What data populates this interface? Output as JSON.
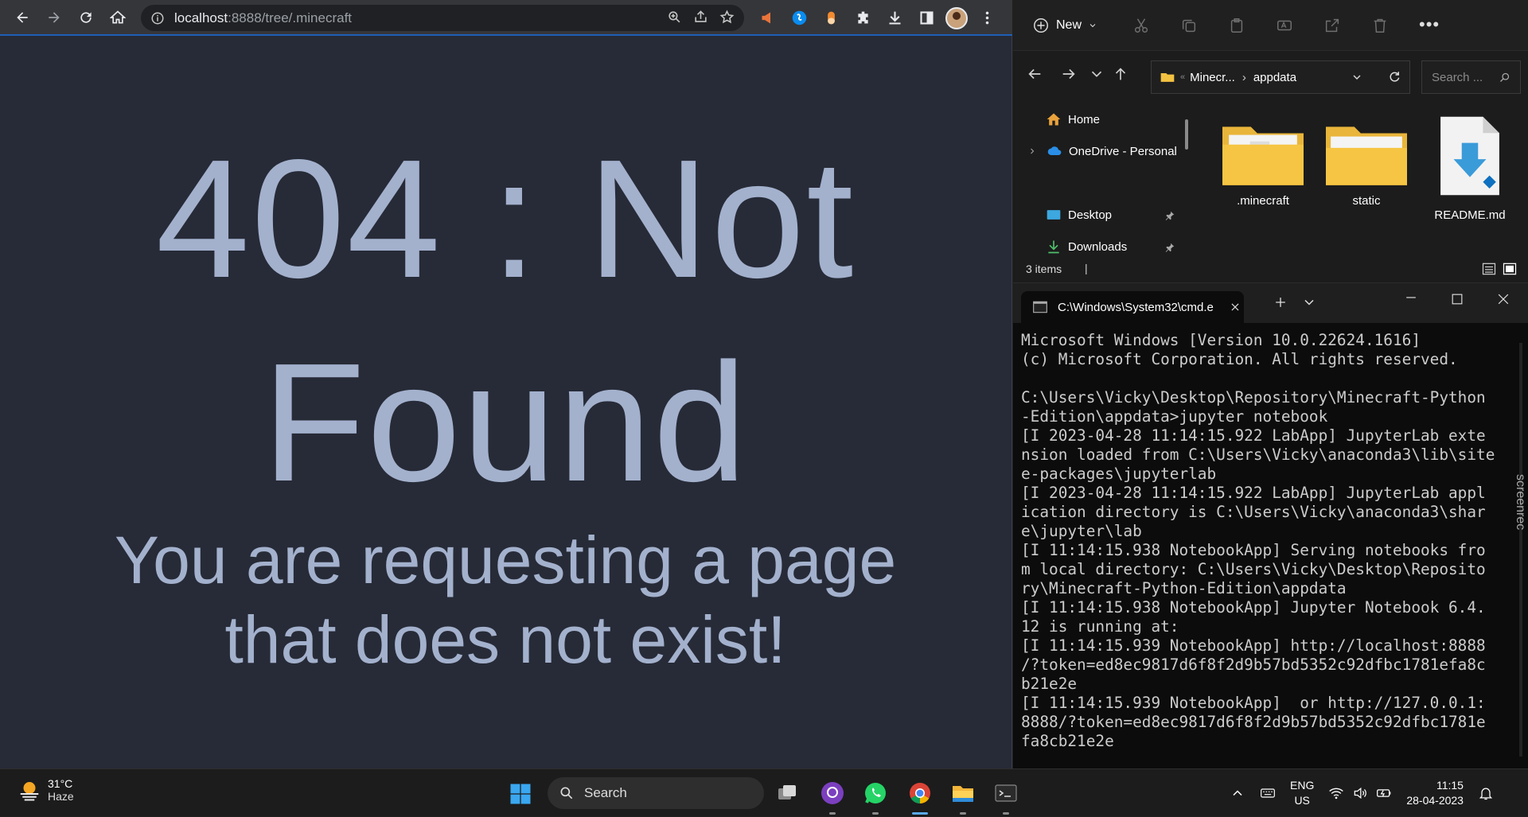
{
  "browser": {
    "url_host": "localhost",
    "url_path": ":8888/tree/.minecraft",
    "page": {
      "title_line1": "404 : Not",
      "title_line2": "Found",
      "subtitle_line1": "You are requesting a page",
      "subtitle_line2": "that does not exist!"
    }
  },
  "explorer": {
    "new_label": "New",
    "breadcrumb": [
      "Minecr...",
      "appdata"
    ],
    "search_placeholder": "Search ...",
    "nav": {
      "home": "Home",
      "onedrive": "OneDrive - Personal",
      "desktop": "Desktop",
      "downloads": "Downloads"
    },
    "files": [
      {
        "name": ".minecraft",
        "type": "folder"
      },
      {
        "name": "static",
        "type": "folder"
      },
      {
        "name": "README.md",
        "type": "markdown-file"
      }
    ],
    "status": "3 items"
  },
  "terminal": {
    "tab_title": "C:\\Windows\\System32\\cmd.e",
    "output": "Microsoft Windows [Version 10.0.22624.1616]\n(c) Microsoft Corporation. All rights reserved.\n\nC:\\Users\\Vicky\\Desktop\\Repository\\Minecraft-Python\n-Edition\\appdata>jupyter notebook\n[I 2023-04-28 11:14:15.922 LabApp] JupyterLab exte\nnsion loaded from C:\\Users\\Vicky\\anaconda3\\lib\\site\ne-packages\\jupyterlab\n[I 2023-04-28 11:14:15.922 LabApp] JupyterLab appl\nication directory is C:\\Users\\Vicky\\anaconda3\\shar\ne\\jupyter\\lab\n[I 11:14:15.938 NotebookApp] Serving notebooks fro\nm local directory: C:\\Users\\Vicky\\Desktop\\Reposito\nry\\Minecraft-Python-Edition\\appdata\n[I 11:14:15.938 NotebookApp] Jupyter Notebook 6.4.\n12 is running at:\n[I 11:14:15.939 NotebookApp] http://localhost:8888\n/?token=ed8ec9817d6f8f2d9b57bd5352c92dfbc1781efa8c\nb21e2e\n[I 11:14:15.939 NotebookApp]  or http://127.0.0.1:\n8888/?token=ed8ec9817d6f8f2d9b57bd5352c92dfbc1781e\nfa8cb21e2e",
    "watermark": "screenrec"
  },
  "taskbar": {
    "weather_temp": "31°C",
    "weather_cond": "Haze",
    "search_label": "Search",
    "lang_top": "ENG",
    "lang_bottom": "US",
    "time": "11:15",
    "date": "28-04-2023"
  },
  "colors": {
    "page_bg": "#272b37",
    "page_text": "#a3b1cd",
    "accent": "#1f5fb8"
  }
}
